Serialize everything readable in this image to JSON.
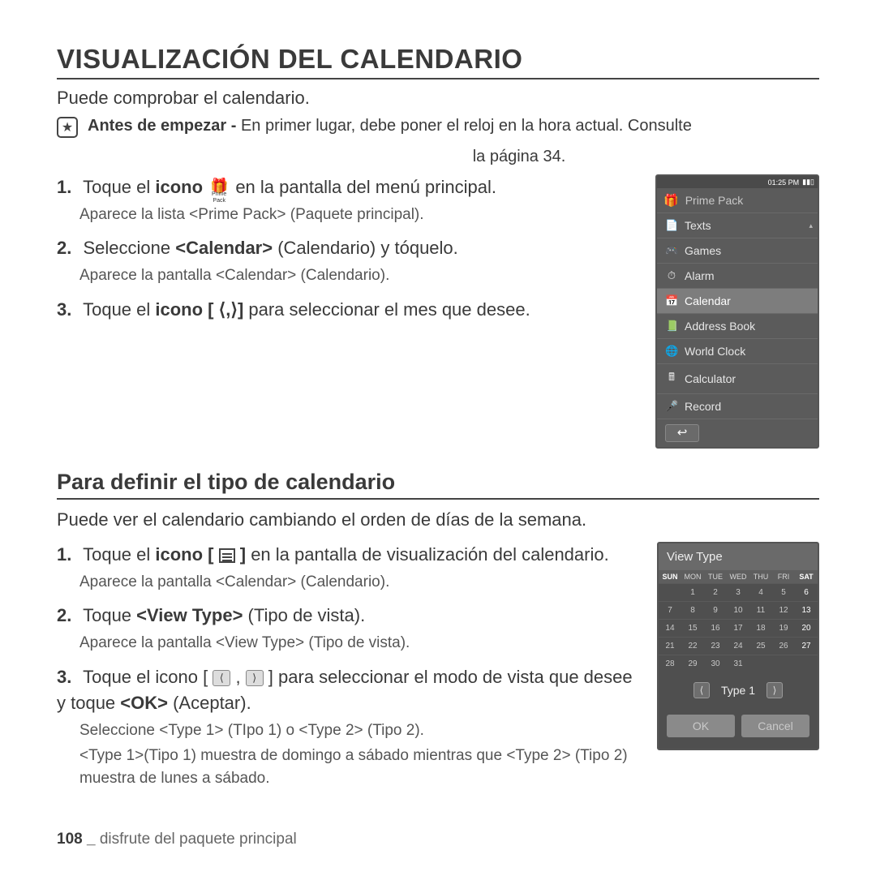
{
  "title": "VISUALIZACIÓN DEL CALENDARIO",
  "intro": "Puede comprobar el calendario.",
  "note_prefix": "Antes de empezar - ",
  "note_text": "En primer lugar, debe poner el reloj en la hora actual. Consulte",
  "note_page": "la página 34.",
  "prime_icon_label": "Prime Pack",
  "step1_a": "Toque el ",
  "step1_b": "icono",
  "step1_c": " en la pantalla del menú principal.",
  "step1_sub": "Aparece la lista <Prime Pack> (Paquete principal).",
  "step2_a": "Seleccione ",
  "step2_b": "<Calendar>",
  "step2_c": " (Calendario) y tóquelo.",
  "step2_sub": "Aparece la pantalla <Calendar> (Calendario).",
  "step3_a": "Toque el ",
  "step3_b": "icono [",
  "step3_c": ",",
  "step3_d": "]",
  "step3_e": " para seleccionar el mes que desee.",
  "device": {
    "time": "01:25 PM",
    "header": "Prime Pack",
    "items": [
      "Texts",
      "Games",
      "Alarm",
      "Calendar",
      "Address Book",
      "World Clock",
      "Calculator",
      "Record"
    ],
    "icons": [
      "📄",
      "🎮",
      "⏱",
      "📅",
      "📗",
      "🌐",
      "🖩",
      "🎤"
    ],
    "selected": 3,
    "back": "↩"
  },
  "h2": "Para deﬁnir el tipo de calendario",
  "intro2": "Puede ver el calendario cambiando el orden de días de la semana.",
  "s2_step1_a": "Toque el ",
  "s2_step1_b": "icono [",
  "s2_step1_c": "]",
  "s2_step1_d": " en la pantalla de visualización del calendario.",
  "s2_step1_sub": "Aparece la pantalla <Calendar> (Calendario).",
  "s2_step2_a": "Toque ",
  "s2_step2_b": "<View Type>",
  "s2_step2_c": " (Tipo de vista).",
  "s2_step2_sub": "Aparece la pantalla <View Type> (Tipo de vista).",
  "s2_step3_a": "Toque el icono [ ",
  "s2_step3_b": " , ",
  "s2_step3_c": " ] para seleccionar el modo de vista que desee y toque ",
  "s2_step3_d": "<OK>",
  "s2_step3_e": " (Aceptar).",
  "s2_step3_sub1": "Seleccione <Type 1> (TIpo 1) o <Type 2> (Tipo 2).",
  "s2_step3_sub2": "<Type 1>(Tipo 1) muestra de domingo a sábado mientras que <Type 2> (Tipo 2) muestra de lunes a sábado.",
  "device2": {
    "header": "View Type",
    "days": [
      "SUN",
      "MON",
      "TUE",
      "WED",
      "THU",
      "FRI",
      "SAT"
    ],
    "cells": [
      "",
      "1",
      "2",
      "3",
      "4",
      "5",
      "6",
      "7",
      "8",
      "9",
      "10",
      "11",
      "12",
      "13",
      "14",
      "15",
      "16",
      "17",
      "18",
      "19",
      "20",
      "21",
      "22",
      "23",
      "24",
      "25",
      "26",
      "27",
      "28",
      "29",
      "30",
      "31",
      "",
      "",
      ""
    ],
    "type": "Type 1",
    "ok": "OK",
    "cancel": "Cancel"
  },
  "footer_page": "108 _",
  "footer_text": " disfrute del paquete principal"
}
